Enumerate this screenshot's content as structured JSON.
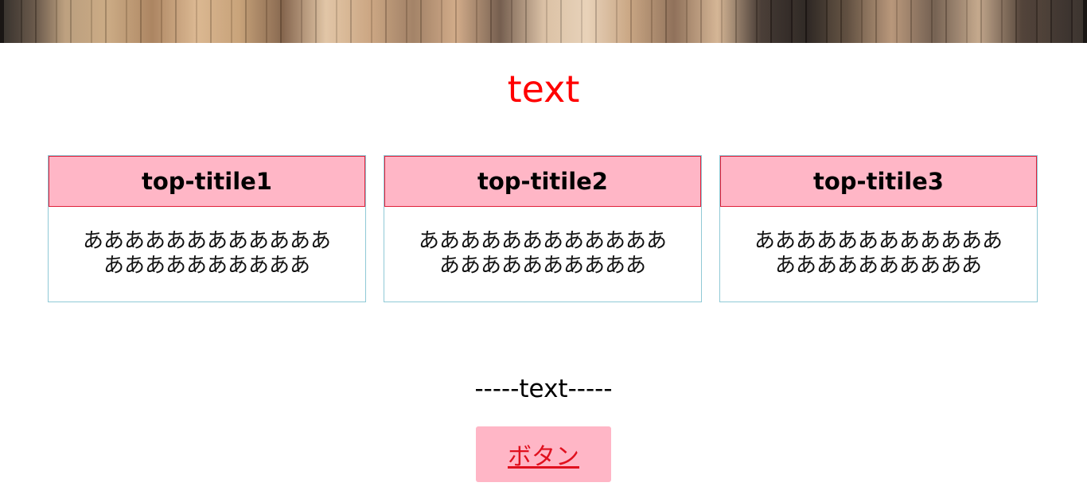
{
  "hero": {
    "image_icon": "bookshelf-painting-image"
  },
  "title": "text",
  "cards": [
    {
      "heading": "top-titile1",
      "body_line1": "ああああああああああああ",
      "body_line2": "ああああああああああ"
    },
    {
      "heading": "top-titile2",
      "body_line1": "ああああああああああああ",
      "body_line2": "ああああああああああ"
    },
    {
      "heading": "top-titile3",
      "body_line1": "ああああああああああああ",
      "body_line2": "ああああああああああ"
    }
  ],
  "subtext": "-----text-----",
  "button": {
    "label": "ボタン"
  },
  "colors": {
    "title": "#ff0000",
    "card_header_bg": "#ffb6c6",
    "card_header_border": "#e0203a",
    "card_border": "#8fc9d6",
    "button_bg": "#ffb6c6",
    "button_text": "#e0101e"
  }
}
